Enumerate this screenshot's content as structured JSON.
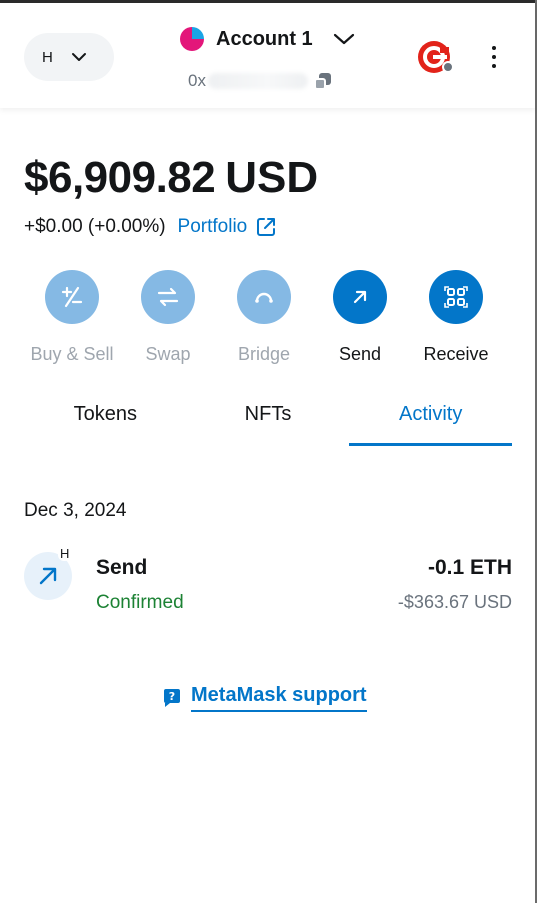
{
  "header": {
    "network_label": "H",
    "account_name": "Account 1",
    "address_prefix": "0x",
    "connection_color": "#e2231a"
  },
  "balance": {
    "amount": "$6,909.82",
    "currency": "USD",
    "change": "+$0.00 (+0.00%)",
    "portfolio_label": "Portfolio"
  },
  "actions": [
    {
      "label": "Buy & Sell",
      "icon": "buy-sell-icon",
      "enabled": false
    },
    {
      "label": "Swap",
      "icon": "swap-icon",
      "enabled": false
    },
    {
      "label": "Bridge",
      "icon": "bridge-icon",
      "enabled": false
    },
    {
      "label": "Send",
      "icon": "send-icon",
      "enabled": true
    },
    {
      "label": "Receive",
      "icon": "receive-icon",
      "enabled": true
    }
  ],
  "tabs": [
    {
      "label": "Tokens",
      "active": false
    },
    {
      "label": "NFTs",
      "active": false
    },
    {
      "label": "Activity",
      "active": true
    }
  ],
  "activity": {
    "date": "Dec 3, 2024",
    "transactions": [
      {
        "title": "Send",
        "status": "Confirmed",
        "amount": "-0.1 ETH",
        "fiat": "-$363.67 USD",
        "network_badge": "H"
      }
    ]
  },
  "support": {
    "label": "MetaMask support"
  },
  "colors": {
    "primary": "#0376c9",
    "disabled_action": "#85b9e4",
    "success": "#1c8234",
    "muted": "#6a737d"
  }
}
